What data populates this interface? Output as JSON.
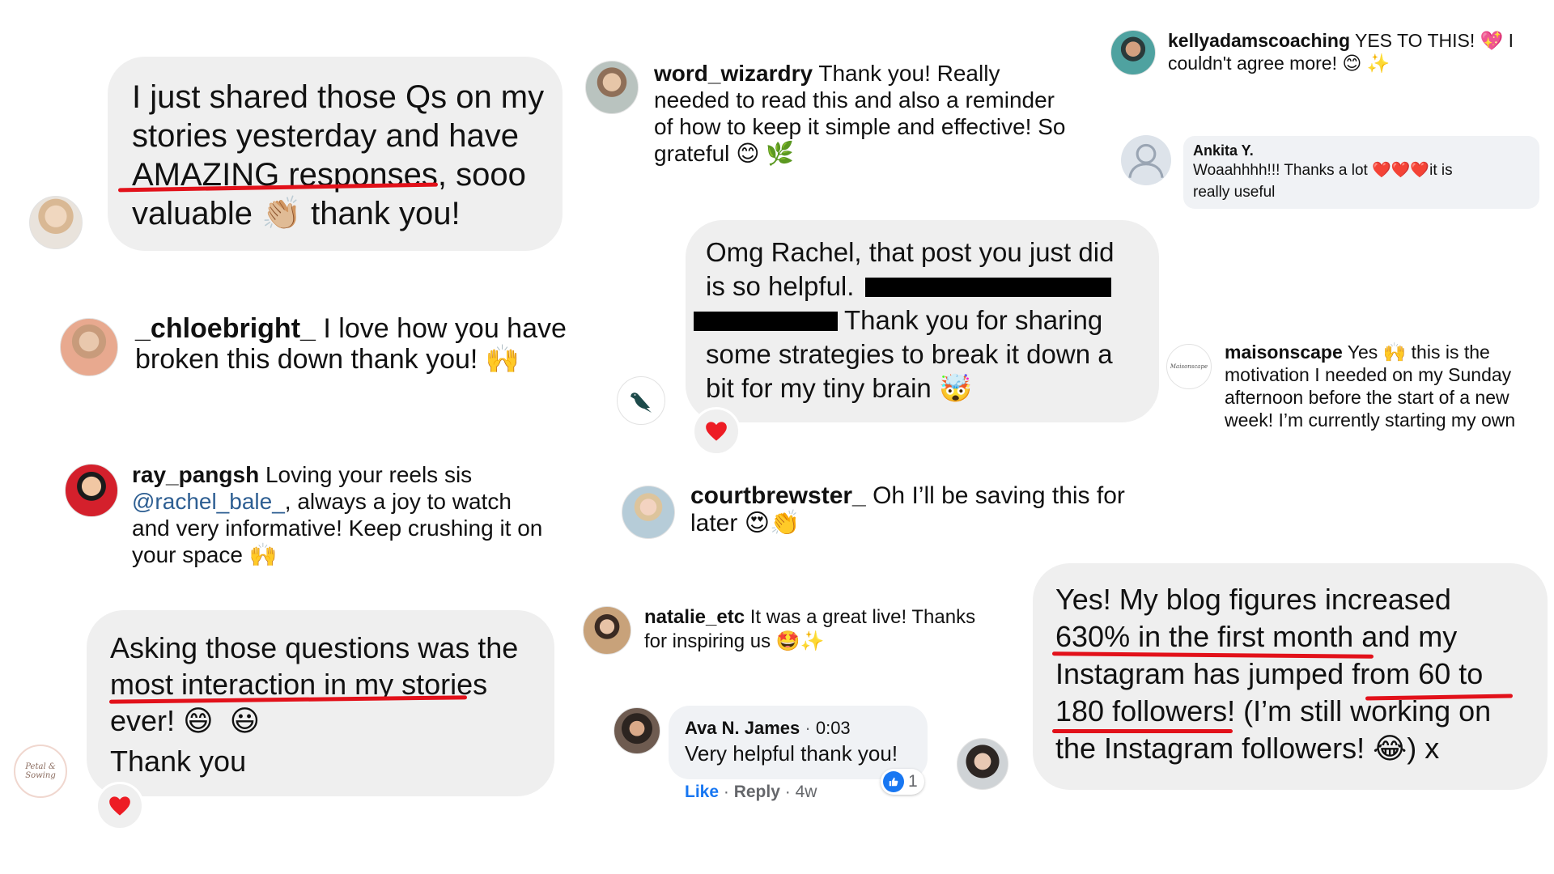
{
  "comments": {
    "c1": {
      "text_line1": "I just shared those Qs on my",
      "text_line2": "stories yesterday and have",
      "text_line3_a": "AMAZING responses",
      "text_line3_b": ", sooo",
      "text_line4_a": "valuable",
      "text_line4_b": "thank you!",
      "emoji_clap": "👏🏼"
    },
    "c2": {
      "username": "_chloebright_",
      "text_a": " I love how you have",
      "text_b": "broken this down thank you!",
      "emoji": "🙌"
    },
    "c3": {
      "username": "ray_pangsh",
      "text_a": " Loving your reels sis",
      "mention": "@rachel_bale_",
      "text_b": ", always a joy to watch",
      "text_c": "and very informative! Keep crushing it on",
      "text_d": "your space",
      "emoji": "🙌"
    },
    "c4": {
      "line1": "Asking those questions was the",
      "line2": "most interaction in my stories",
      "line3": "ever!",
      "emoji_a": "😄",
      "emoji_b": "😃",
      "line4": "Thank you",
      "reaction": "heart"
    },
    "c5": {
      "username": "word_wizardry",
      "text_a": " Thank you! Really",
      "text_b": "needed to read this and also a reminder",
      "text_c": "of how to keep it simple and effective! So",
      "text_d": "grateful",
      "emoji_a": "😊",
      "emoji_b": "🌿"
    },
    "c6": {
      "line1": "Omg Rachel, that post you just did",
      "line2": "is so helpful.",
      "line3": "Thank you for sharing",
      "line4": "some strategies to break it down a",
      "line5": "bit for my tiny brain",
      "emoji": "🤯",
      "reaction": "heart"
    },
    "c7": {
      "username": "courtbrewster_",
      "text_a": " Oh I’ll be saving this for",
      "text_b": "later",
      "emoji_a": "😍",
      "emoji_b": "👏"
    },
    "c8": {
      "username": "natalie_etc",
      "text_a": " It was a great live! Thanks",
      "text_b": "for inspiring us",
      "emoji_a": "🤩",
      "emoji_b": "✨"
    },
    "c9": {
      "name": "Ava N. James",
      "time": "0:03",
      "text": "Very helpful thank you!",
      "like": "Like",
      "reply": "Reply",
      "age": "4w",
      "reaction_count": "1"
    },
    "c10": {
      "username": "kellyadamscoaching",
      "text_a": " YES TO THIS! ",
      "text_b": " I",
      "text_c": "couldn't agree more! ",
      "emoji_heart": "💖",
      "emoji_smile": "😊",
      "emoji_spark": "✨"
    },
    "c11": {
      "name": "Ankita Y.",
      "text_a": "Woaahhhh!!! Thanks a lot ",
      "hearts": "❤️❤️❤️",
      "text_b": "it is",
      "text_c": "really useful"
    },
    "c12": {
      "username": "maisonscape",
      "text_a": " Yes ",
      "emoji": "🙌",
      "text_b": " this is the",
      "text_c": "motivation I needed on my Sunday",
      "text_d": "afternoon before the start of a new",
      "text_e": "week! I’m currently starting my own",
      "avatar_text": "Maisonscape"
    },
    "c13": {
      "line1": "Yes! My blog figures increased",
      "line2_a": "630% in the first month",
      "line2_b": " and my",
      "line3_a": "Instagram has jumped ",
      "line3_b": "from 60 to",
      "line4_a": "180 followers!",
      "line4_b": " (I’m still working on",
      "line5_a": "the Instagram followers! ",
      "emoji": "😂",
      "line5_b": ") x"
    },
    "petal_logo": {
      "line1": "Petal &",
      "line2": "Sowing"
    }
  },
  "colors": {
    "bubble": "#efefef",
    "underline": "#e2111a",
    "link": "#2d5e92",
    "fb_blue": "#1877f2",
    "heart": "#ed1c24"
  }
}
